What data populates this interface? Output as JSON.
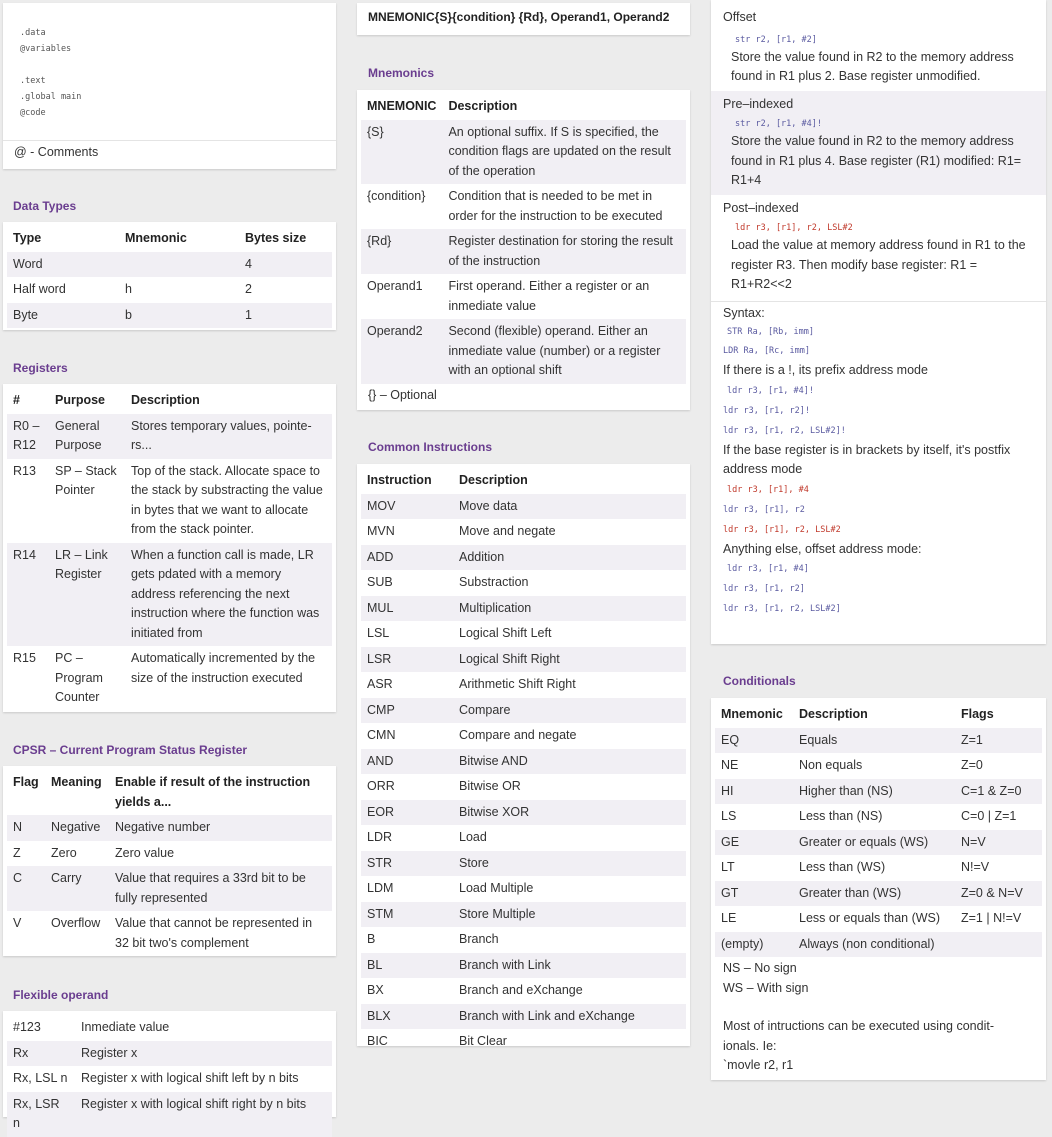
{
  "code_box": {
    "lines": [
      ".data",
      "@variables",
      "",
      ".text",
      ".global main",
      "@code"
    ],
    "comment_note": "@ - Comments"
  },
  "data_types": {
    "title": "Data Types",
    "headers": [
      "Type",
      "Mnemonic",
      "Bytes size"
    ],
    "rows": [
      [
        "Word",
        "",
        "4"
      ],
      [
        "Half word",
        "h",
        "2"
      ],
      [
        "Byte",
        "b",
        "1"
      ]
    ]
  },
  "registers": {
    "title": "Registers",
    "headers": [
      "#",
      "Purpose",
      "Description"
    ],
    "rows": [
      [
        "R0 – R12",
        "General Purpose",
        "Stores temporary values, pointe-rs..."
      ],
      [
        "R13",
        "SP – Stack Pointer",
        "Top of the stack. Allocate space to the stack by substracting the value in bytes that we want to allocate from the stack pointer."
      ],
      [
        "R14",
        "LR – Link Register",
        "When a function call is made, LR gets pdated with a memory address referencing the next instruction where the function was initiated from"
      ],
      [
        "R15",
        "PC – Program Counter",
        "Automatically incremented by the size of the instruction executed"
      ]
    ]
  },
  "cpsr": {
    "title": "CPSR – Current Program Status Register",
    "headers": [
      "Flag",
      "Meaning",
      "Enable if result of the instruction yields a..."
    ],
    "rows": [
      [
        "N",
        "Negative",
        "Negative number"
      ],
      [
        "Z",
        "Zero",
        "Zero value"
      ],
      [
        "C",
        "Carry",
        "Value that requires a 33rd bit to be fully represented"
      ],
      [
        "V",
        "Overflow",
        "Value that cannot be represented in 32 bit two's complement"
      ]
    ]
  },
  "flex_operand": {
    "title": "Flexible operand",
    "rows": [
      [
        "#123",
        "Inmediate value"
      ],
      [
        "Rx",
        "Register x"
      ],
      [
        "Rx, LSL n",
        "Register x with logical shift left by n bits"
      ],
      [
        "Rx, LSR n",
        "Register x with logical shift right by n bits"
      ]
    ]
  },
  "syntax_header": "MNEMONIC{S}{condition} {Rd}, Operand1, Operand2",
  "mnemonics": {
    "title": "Mnemonics",
    "headers": [
      "MNEMONIC",
      "Description"
    ],
    "rows": [
      [
        "{S}",
        "An optional suffix. If S is specified, the condition flags are updated on the result of the operation"
      ],
      [
        "{condition}",
        "Condition that is needed to be met in order for the instruction to be executed"
      ],
      [
        "{Rd}",
        "Register destination for storing the result of the instruction"
      ],
      [
        "Operand1",
        "First operand. Either a register or an inmediate value"
      ],
      [
        "Operand2",
        "Second (flexible) operand. Either an inmediate value (number) or a register with an optional shift"
      ]
    ],
    "note": "{} – Optional"
  },
  "instructions": {
    "title": "Common Instructions",
    "headers": [
      "Instruction",
      "Description"
    ],
    "rows": [
      [
        "MOV",
        "Move data"
      ],
      [
        "MVN",
        "Move and negate"
      ],
      [
        "ADD",
        "Addition"
      ],
      [
        "SUB",
        "Substraction"
      ],
      [
        "MUL",
        "Multiplication"
      ],
      [
        "LSL",
        "Logical Shift Left"
      ],
      [
        "LSR",
        "Logical Shift Right"
      ],
      [
        "ASR",
        "Arithmetic Shift Right"
      ],
      [
        "CMP",
        "Compare"
      ],
      [
        "CMN",
        "Compare and negate"
      ],
      [
        "AND",
        "Bitwise AND"
      ],
      [
        "ORR",
        "Bitwise OR"
      ],
      [
        "EOR",
        "Bitwise XOR"
      ],
      [
        "LDR",
        "Load"
      ],
      [
        "STR",
        "Store"
      ],
      [
        "LDM",
        "Load Multiple"
      ],
      [
        "STM",
        "Store Multiple"
      ],
      [
        "B",
        "Branch"
      ],
      [
        "BL",
        "Branch with Link"
      ],
      [
        "BX",
        "Branch and eXchange"
      ],
      [
        "BLX",
        "Branch with Link and eXchange"
      ],
      [
        "BIC",
        "Bit Clear"
      ]
    ]
  },
  "addressing": {
    "offset_label": "Offset",
    "offset_code": "str r2, [r1, #2]",
    "offset_text": "Store the value found in R2 to the memory address found in R1 plus 2. Base register unmodified.",
    "pre_label": "Pre–indexed",
    "pre_code": "str r2, [r1, #4]!",
    "pre_text": "Store the value found in R2 to the memory address found in R1 plus 4. Base register (R1) modified: R1= R1+4",
    "post_label": "Post–indexed",
    "post_code": "ldr r3, [r1], r2, LSL#2",
    "post_text": "Load the value at memory address found in R1 to the register R3. Then modify base register: R1 = R1+R2<<2",
    "syntax_label": "Syntax:",
    "syntax_code": [
      "STR Ra, [Rb, imm]",
      "LDR Ra, [Rc, imm]"
    ],
    "prefix_text": "If there is a !, its prefix address mode",
    "prefix_code": [
      "ldr   r3, [r1, #4]!",
      "ldr   r3, [r1, r2]!",
      "ldr   r3, [r1, r2, LSL#2]!"
    ],
    "postfix_text": "If the base register is in brackets by itself, it's postfix address mode",
    "postfix_code": [
      "ldr   r3, [r1], #4",
      "ldr   r3, [r1], r2",
      "ldr   r3, [r1], r2, LSL#2"
    ],
    "offset_mode_text": "Anything else, offset address mode:",
    "offset_mode_code": [
      "ldr   r3, [r1, #4]",
      "ldr   r3, [r1, r2]",
      "ldr   r3, [r1, r2, LSL#2]"
    ]
  },
  "conditionals": {
    "title": "Conditionals",
    "headers": [
      "Mnemonic",
      "Description",
      "Flags"
    ],
    "rows": [
      [
        "EQ",
        "Equals",
        "Z=1"
      ],
      [
        "NE",
        "Non equals",
        "Z=0"
      ],
      [
        "HI",
        "Higher than (NS)",
        "C=1 & Z=0"
      ],
      [
        "LS",
        "Less than (NS)",
        "C=0 | Z=1"
      ],
      [
        "GE",
        "Greater or equals (WS)",
        "N=V"
      ],
      [
        "LT",
        "Less than (WS)",
        "N!=V"
      ],
      [
        "GT",
        "Greater than (WS)",
        "Z=0 & N=V"
      ],
      [
        "LE",
        "Less or equals than (WS)",
        "Z=1 | N!=V"
      ],
      [
        "(empty)",
        "Always (non conditional)",
        ""
      ]
    ],
    "notes": [
      "NS – No sign",
      "WS – With sign"
    ],
    "footer": [
      "Most of intructions can be executed using condit-",
      "ionals. Ie:",
      "`movle r2, r1"
    ]
  }
}
